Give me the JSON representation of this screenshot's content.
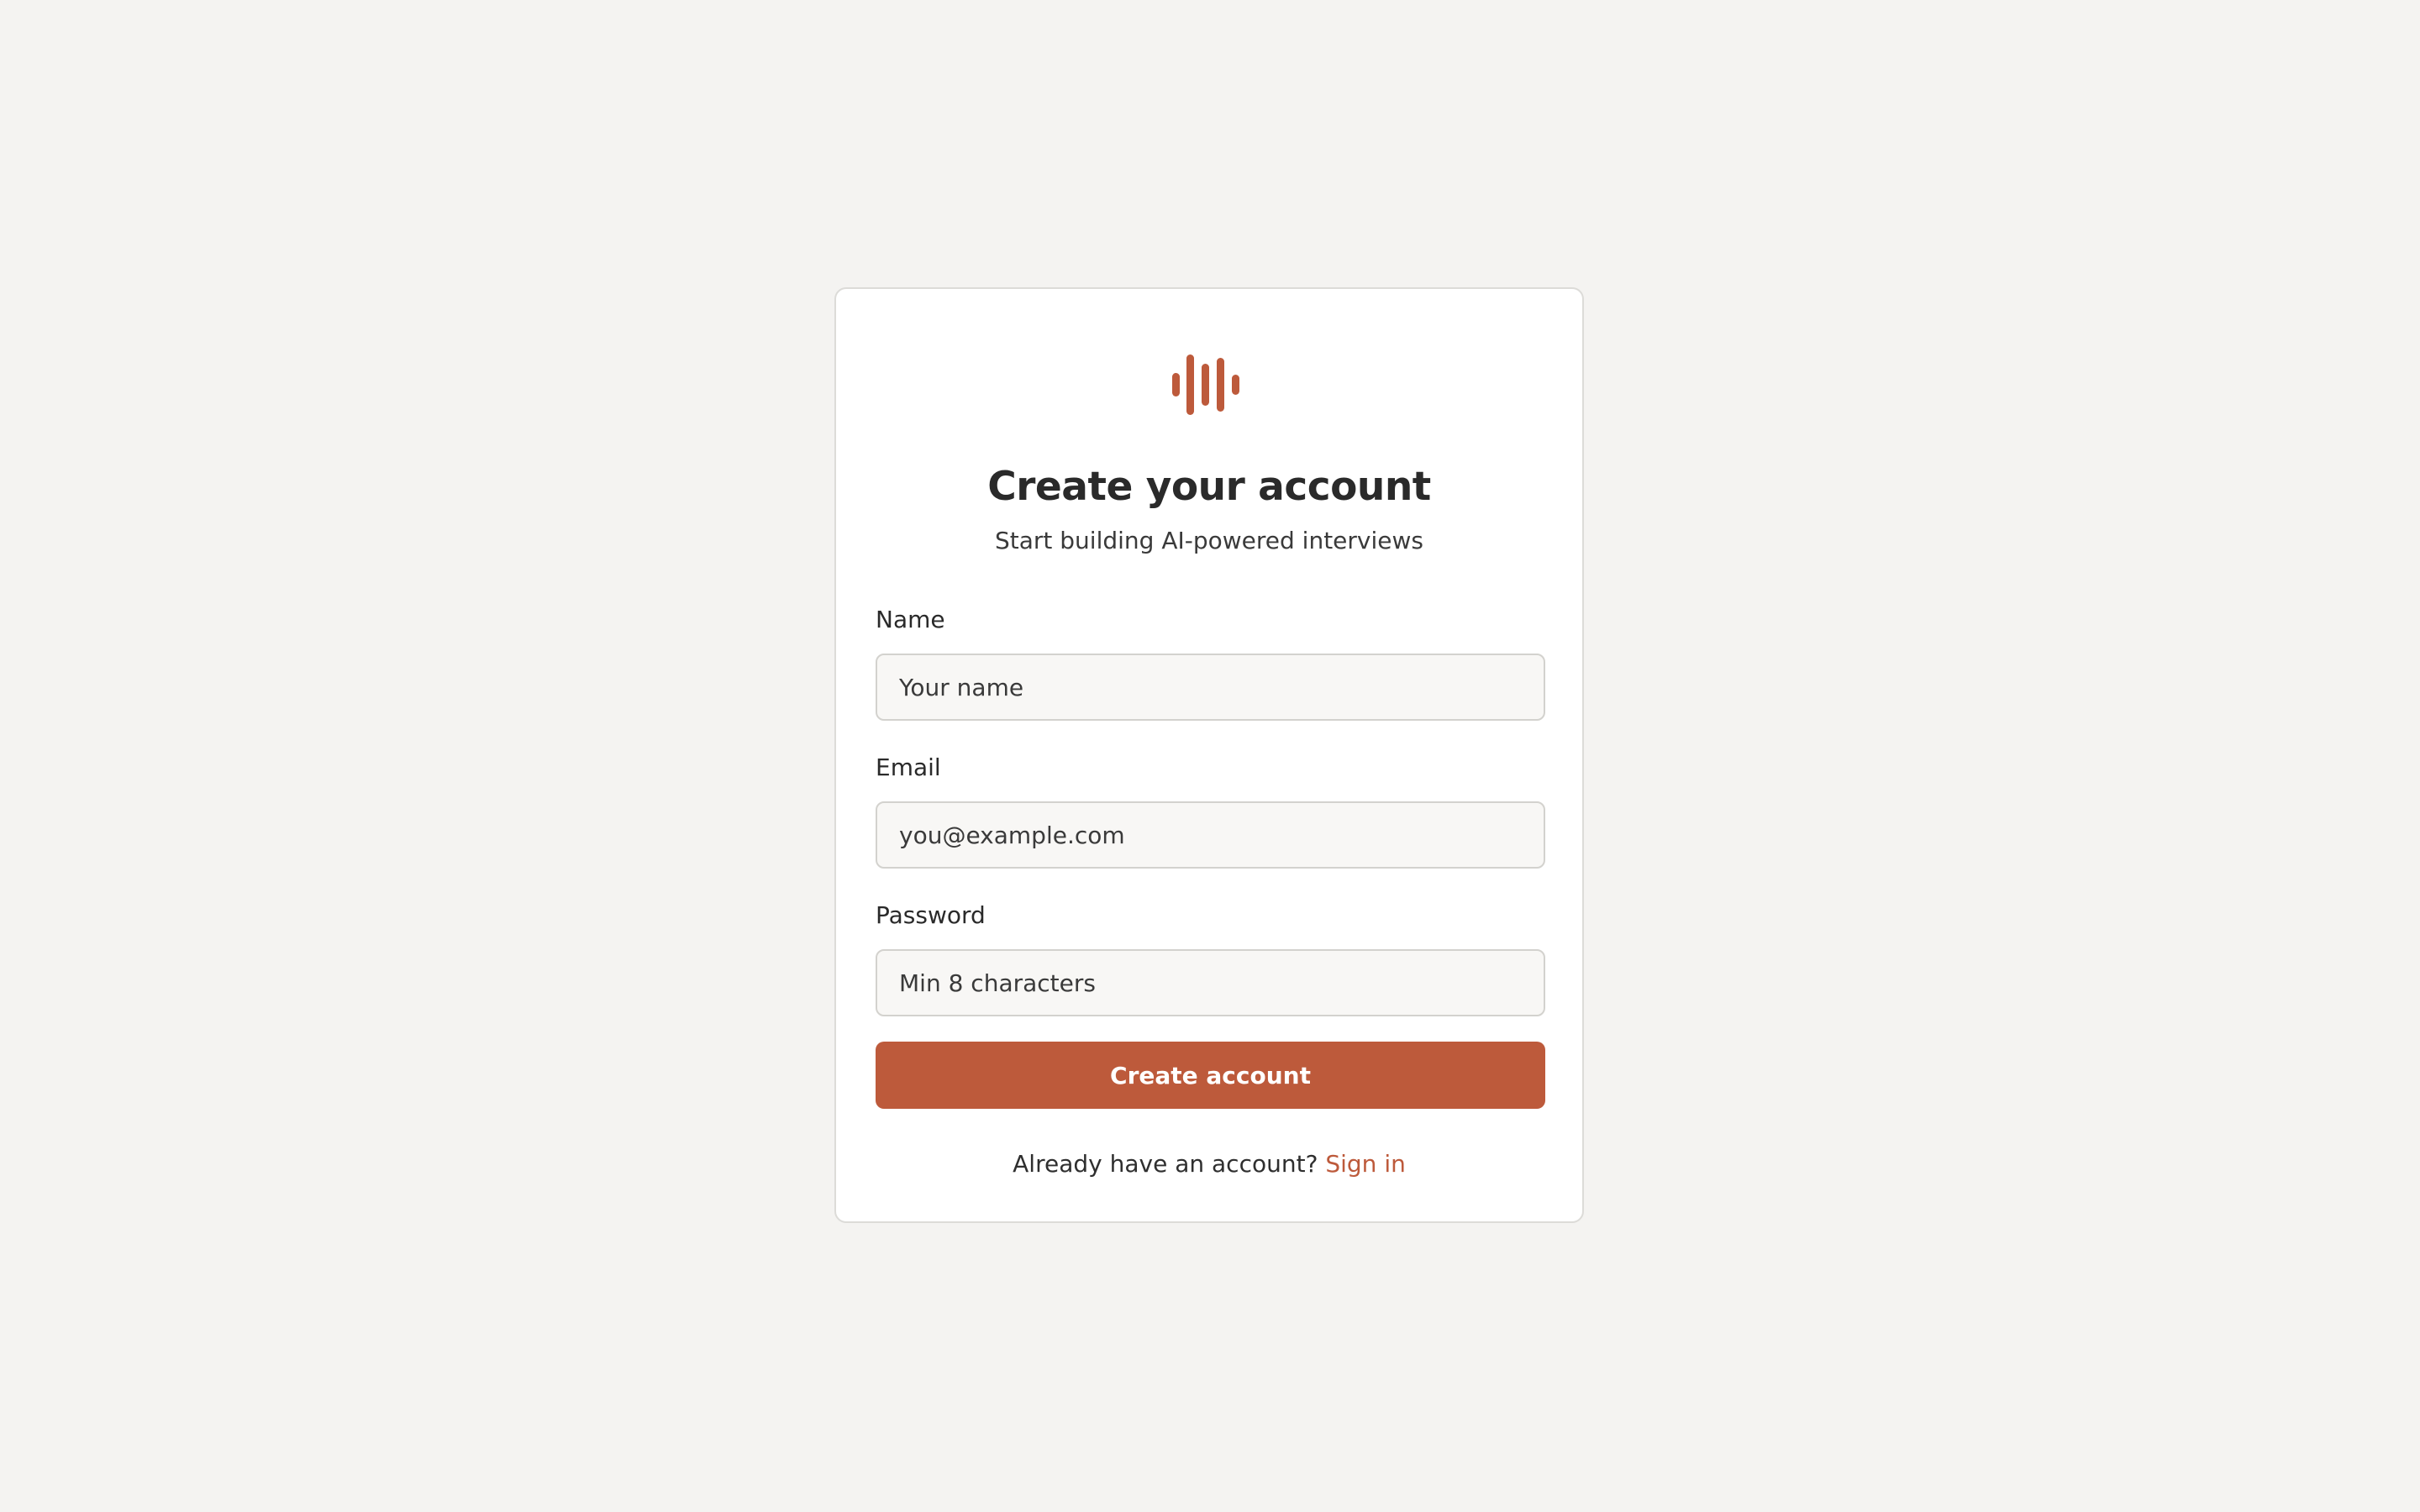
{
  "brand": {
    "logo_icon": "waveform-icon",
    "accent_color": "#bd5a3b"
  },
  "header": {
    "title": "Create your account",
    "subtitle": "Start building AI-powered interviews"
  },
  "form": {
    "name": {
      "label": "Name",
      "value": "",
      "placeholder": "Your name"
    },
    "email": {
      "label": "Email",
      "value": "",
      "placeholder": "you@example.com"
    },
    "password": {
      "label": "Password",
      "value": "",
      "placeholder": "Min 8 characters"
    },
    "submit_label": "Create account"
  },
  "footer": {
    "prompt": "Already have an account?",
    "link_label": "Sign in"
  }
}
